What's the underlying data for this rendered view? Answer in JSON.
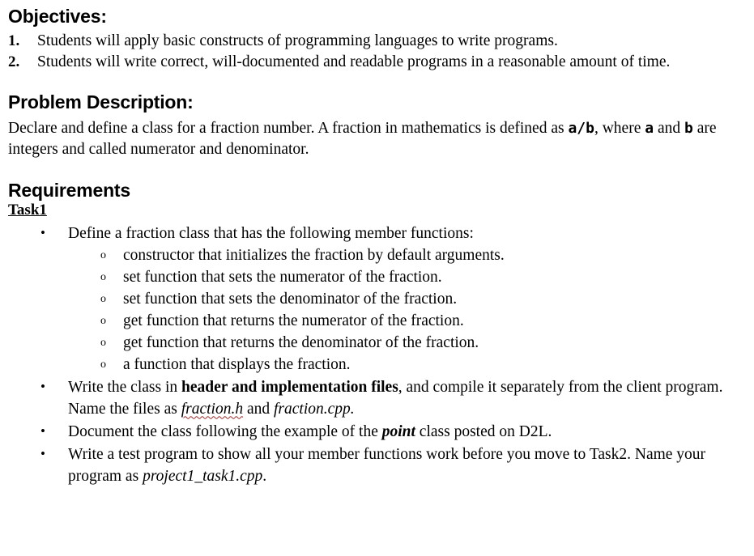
{
  "document": {
    "objectives": {
      "heading": "Objectives:",
      "items": [
        {
          "marker": "1.",
          "text": "Students will apply basic constructs of programming languages to write programs."
        },
        {
          "marker": "2.",
          "text": "Students will write correct, will-documented and readable programs in a reasonable amount of time."
        }
      ]
    },
    "problem_description": {
      "heading": "Problem Description:",
      "paragraph": {
        "part1": "Declare and define a class for a fraction number. A fraction in mathematics is defined as ",
        "code_ab": "a/b",
        "part2": ", where ",
        "code_a": "a",
        "part3": " and ",
        "code_b": "b",
        "part4": " are integers and called numerator and denominator."
      }
    },
    "requirements": {
      "heading": "Requirements",
      "task_label": "Task1",
      "bullets": [
        {
          "marker": "•",
          "text": "Define a fraction class that has the following member functions:",
          "sub_marker": "o",
          "sub_items": [
            "constructor that initializes the fraction by default arguments.",
            "set function that sets the numerator of the fraction.",
            "set function that sets the denominator of the fraction.",
            "get function that returns the numerator of the fraction.",
            "get function that returns the denominator of the fraction.",
            "a function that displays the fraction."
          ]
        },
        {
          "marker": "•",
          "part1": "Write the class in ",
          "bold1": "header and implementation files",
          "part2": ", and compile it separately from the client program. Name the files as ",
          "filename1": "fraction.h",
          "part3": " and ",
          "filename2": "fraction.cpp",
          "part4": "."
        },
        {
          "marker": "•",
          "part1": "Document the class following the example of the ",
          "bolditalic1": "point",
          "part2": " class posted on D2L."
        },
        {
          "marker": "•",
          "part1": "Write a test program to show all your member functions work before you move to Task2. Name your program as ",
          "italic1": "project1_task1.cpp",
          "part2": "."
        }
      ]
    }
  },
  "colors": {
    "text": "#000000",
    "background": "#ffffff",
    "spell_error_underline": "#9e2a2a"
  }
}
